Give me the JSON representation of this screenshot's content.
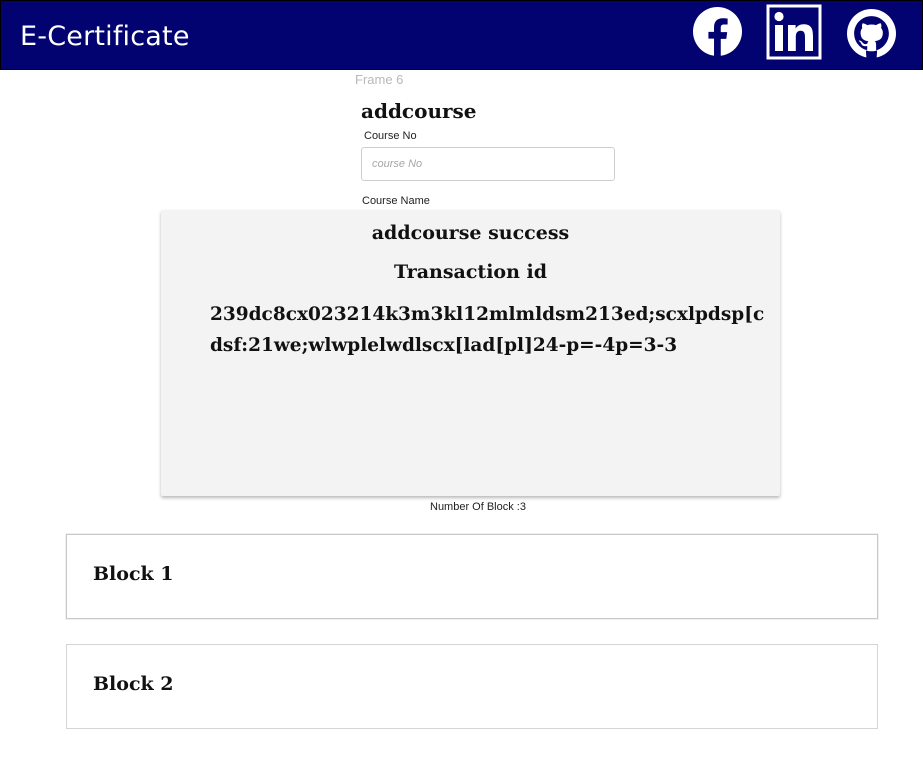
{
  "header": {
    "brand": "E-Certificate",
    "links": [
      {
        "icon": "facebook-icon"
      },
      {
        "icon": "linkedin-icon"
      },
      {
        "icon": "github-icon"
      }
    ],
    "background_color": "#020270"
  },
  "frame_label": "Frame 6",
  "form": {
    "title": "addcourse",
    "course_no_label": "Course No",
    "course_no_placeholder": "course No",
    "course_no_value": "",
    "course_name_label": "Course Name"
  },
  "result": {
    "status": "addcourse success",
    "transaction_label": "Transaction id",
    "transaction_id": "239dc8cx023214k3m3kl12mlmldsm213ed;scxlpdsp[cdsf:21we;wlwplelwdlscx[lad[pl]24-p=-4p=3-3"
  },
  "blocks": {
    "count_text": "Number Of Block :3",
    "items": [
      {
        "title": "Block 1"
      },
      {
        "title": "Block 2"
      }
    ]
  }
}
